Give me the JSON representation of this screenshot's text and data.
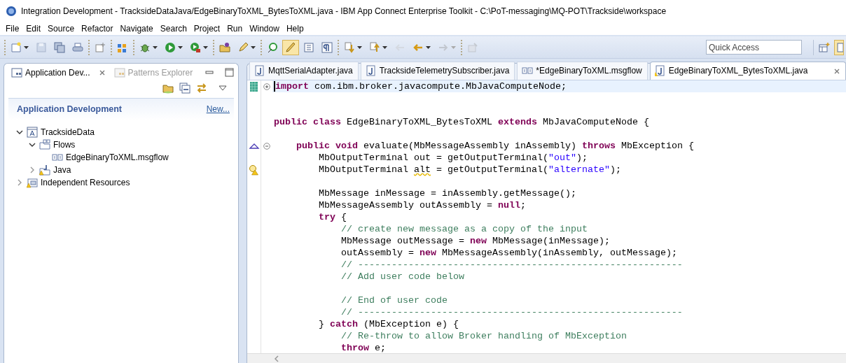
{
  "window": {
    "title": "Integration Development - TracksideDataJava/EdgeBinaryToXML_BytesToXML.java - IBM App Connect Enterprise Toolkit - C:\\PoT-messaging\\MQ-POT\\Trackside\\workspace"
  },
  "menu": [
    "File",
    "Edit",
    "Source",
    "Refactor",
    "Navigate",
    "Search",
    "Project",
    "Run",
    "Window",
    "Help"
  ],
  "toolbar": {
    "groups": [
      [
        {
          "dropdown": true,
          "disabled": false,
          "pressed": false
        },
        {
          "dropdown": false,
          "disabled": true,
          "pressed": false
        },
        {
          "dropdown": false,
          "disabled": false,
          "pressed": false
        },
        {
          "dropdown": false,
          "disabled": false,
          "pressed": false
        }
      ],
      [
        {
          "dropdown": false,
          "disabled": false,
          "pressed": false
        }
      ],
      [
        {
          "dropdown": false,
          "disabled": false,
          "pressed": false
        }
      ],
      [
        {
          "dropdown": true,
          "disabled": false,
          "pressed": false
        },
        {
          "dropdown": true,
          "disabled": false,
          "pressed": false
        },
        {
          "dropdown": true,
          "disabled": false,
          "pressed": false
        }
      ],
      [
        {
          "dropdown": false,
          "disabled": false,
          "pressed": false
        },
        {
          "dropdown": true,
          "disabled": false,
          "pressed": false
        }
      ],
      [
        {
          "dropdown": false,
          "disabled": false,
          "pressed": false
        },
        {
          "dropdown": false,
          "disabled": false,
          "pressed": true
        },
        {
          "dropdown": false,
          "disabled": false,
          "pressed": false
        },
        {
          "dropdown": false,
          "disabled": false,
          "pressed": false
        }
      ],
      [
        {
          "dropdown": true,
          "disabled": false,
          "pressed": false
        },
        {
          "dropdown": true,
          "disabled": false,
          "pressed": false
        },
        {
          "dropdown": false,
          "disabled": true,
          "pressed": false
        },
        {
          "dropdown": true,
          "disabled": false,
          "pressed": false
        },
        {
          "dropdown": true,
          "disabled": true,
          "pressed": false
        }
      ],
      [
        {
          "dropdown": false,
          "disabled": true,
          "pressed": false
        }
      ]
    ],
    "quick_access": {
      "placeholder": "Quick Access"
    }
  },
  "left_panel": {
    "tabs": [
      {
        "label": "Application Dev...",
        "selected": true
      },
      {
        "label": "Patterns Explorer",
        "selected": false
      }
    ],
    "section": {
      "title": "Application Development",
      "link": "New..."
    },
    "tree": [
      {
        "label": "TracksideData",
        "kind": "application",
        "expanded": true,
        "children": [
          {
            "label": "Flows",
            "kind": "folder",
            "expanded": true,
            "children": [
              {
                "label": "EdgeBinaryToXML.msgflow",
                "kind": "flow"
              }
            ]
          },
          {
            "label": "Java",
            "kind": "java-folder",
            "expanded": false
          }
        ]
      },
      {
        "label": "Independent Resources",
        "kind": "resources",
        "expanded": false
      }
    ]
  },
  "editor": {
    "tabs": [
      {
        "label": "MqttSerialAdapter.java",
        "kind": "java",
        "selected": false
      },
      {
        "label": "TracksideTelemetrySubscriber.java",
        "kind": "java",
        "selected": false
      },
      {
        "label": "*EdgeBinaryToXML.msgflow",
        "kind": "flow",
        "selected": false
      },
      {
        "label": "EdgeBinaryToXML_BytesToXML.java",
        "kind": "java",
        "selected": true
      }
    ],
    "lines": [
      {
        "current": true,
        "gutter": {
          "kind": "bookmark"
        },
        "fold": {
          "collapsed": true
        },
        "tokens": [
          {
            "kind": "keyword",
            "text": "import"
          },
          {
            "kind": "plain",
            "text": " com.ibm.broker.javacompute.MbJavaComputeNode;"
          }
        ]
      },
      {
        "current": false
      },
      {
        "current": false
      },
      {
        "current": false,
        "tokens": [
          {
            "kind": "keyword",
            "text": "public"
          },
          {
            "kind": "keyword",
            "text": " class"
          },
          {
            "kind": "plain",
            "text": " EdgeBinaryToXML_BytesToXML "
          },
          {
            "kind": "keyword",
            "text": "extends"
          },
          {
            "kind": "plain",
            "text": " MbJavaComputeNode {"
          }
        ]
      },
      {
        "current": false
      },
      {
        "current": false,
        "gutter": {
          "kind": "override"
        },
        "fold": {
          "collapsed": false
        },
        "tokens": [
          {
            "kind": "keyword",
            "text": "    public"
          },
          {
            "kind": "keyword",
            "text": " void"
          },
          {
            "kind": "plain",
            "text": " evaluate(MbMessageAssembly inAssembly) "
          },
          {
            "kind": "keyword",
            "text": "throws"
          },
          {
            "kind": "plain",
            "text": " MbException {"
          }
        ]
      },
      {
        "current": false,
        "tokens": [
          {
            "kind": "plain",
            "text": "        MbOutputTerminal out = getOutputTerminal("
          },
          {
            "kind": "string",
            "text": "\"out\""
          },
          {
            "kind": "plain",
            "text": ");"
          }
        ]
      },
      {
        "current": false,
        "gutter": {
          "kind": "warning"
        },
        "tokens": [
          {
            "kind": "plain",
            "text": "        MbOutputTerminal "
          },
          {
            "kind": "warning",
            "text": "alt"
          },
          {
            "kind": "plain",
            "text": " = getOutputTerminal("
          },
          {
            "kind": "string",
            "text": "\"alternate\""
          },
          {
            "kind": "plain",
            "text": ");"
          }
        ]
      },
      {
        "current": false
      },
      {
        "current": false,
        "tokens": [
          {
            "kind": "plain",
            "text": "        MbMessage inMessage = inAssembly.getMessage();"
          }
        ]
      },
      {
        "current": false,
        "tokens": [
          {
            "kind": "plain",
            "text": "        MbMessageAssembly outAssembly = "
          },
          {
            "kind": "keyword",
            "text": "null"
          },
          {
            "kind": "plain",
            "text": ";"
          }
        ]
      },
      {
        "current": false,
        "tokens": [
          {
            "kind": "keyword",
            "text": "        try"
          },
          {
            "kind": "plain",
            "text": " {"
          }
        ]
      },
      {
        "current": false,
        "tokens": [
          {
            "kind": "comment",
            "text": "            // create new message as a copy of the input"
          }
        ]
      },
      {
        "current": false,
        "tokens": [
          {
            "kind": "plain",
            "text": "            MbMessage outMessage = "
          },
          {
            "kind": "keyword",
            "text": "new"
          },
          {
            "kind": "plain",
            "text": " MbMessage(inMessage);"
          }
        ]
      },
      {
        "current": false,
        "tokens": [
          {
            "kind": "plain",
            "text": "            outAssembly = "
          },
          {
            "kind": "keyword",
            "text": "new"
          },
          {
            "kind": "plain",
            "text": " MbMessageAssembly(inAssembly, outMessage);"
          }
        ]
      },
      {
        "current": false,
        "tokens": [
          {
            "kind": "comment",
            "text": "            // ----------------------------------------------------------"
          }
        ]
      },
      {
        "current": false,
        "tokens": [
          {
            "kind": "comment",
            "text": "            // Add user code below"
          }
        ]
      },
      {
        "current": false
      },
      {
        "current": false,
        "tokens": [
          {
            "kind": "comment",
            "text": "            // End of user code"
          }
        ]
      },
      {
        "current": false,
        "tokens": [
          {
            "kind": "comment",
            "text": "            // ----------------------------------------------------------"
          }
        ]
      },
      {
        "current": false,
        "tokens": [
          {
            "kind": "plain",
            "text": "        } "
          },
          {
            "kind": "keyword",
            "text": "catch"
          },
          {
            "kind": "plain",
            "text": " (MbException e) {"
          }
        ]
      },
      {
        "current": false,
        "tokens": [
          {
            "kind": "comment",
            "text": "            // Re-throw to allow Broker handling of MbException"
          }
        ]
      },
      {
        "current": false,
        "tokens": [
          {
            "kind": "keyword",
            "text": "            throw"
          },
          {
            "kind": "plain",
            "text": " e;"
          }
        ]
      }
    ]
  }
}
